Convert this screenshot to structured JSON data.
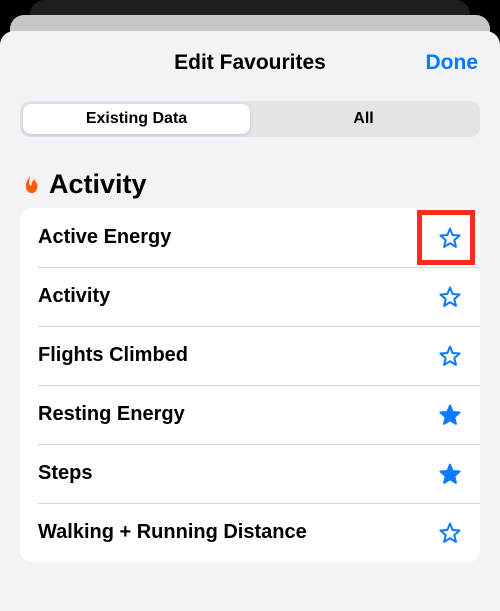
{
  "header": {
    "title": "Edit Favourites",
    "done": "Done"
  },
  "segmented": {
    "options": [
      "Existing Data",
      "All"
    ],
    "selected": 0
  },
  "section": {
    "icon": "flame-icon",
    "title": "Activity",
    "accent": "#FF5B0A"
  },
  "rows": [
    {
      "label": "Active Energy",
      "favorite": false,
      "highlighted": true
    },
    {
      "label": "Activity",
      "favorite": false,
      "highlighted": false
    },
    {
      "label": "Flights Climbed",
      "favorite": false,
      "highlighted": false
    },
    {
      "label": "Resting Energy",
      "favorite": true,
      "highlighted": false
    },
    {
      "label": "Steps",
      "favorite": true,
      "highlighted": false
    },
    {
      "label": "Walking + Running Distance",
      "favorite": false,
      "highlighted": false
    }
  ],
  "star_color": "#0a7bff"
}
